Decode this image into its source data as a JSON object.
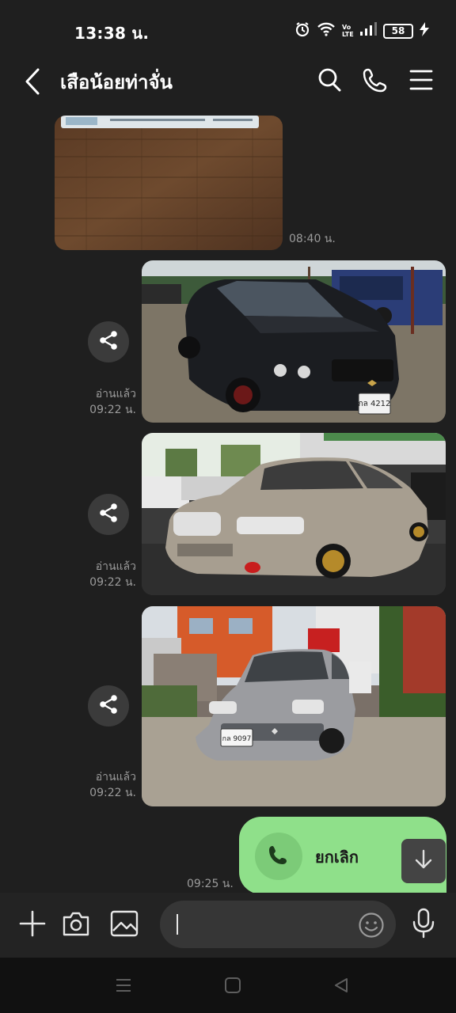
{
  "status_bar": {
    "time": "13:38 น.",
    "battery": "58",
    "network_label": "Vo LTE"
  },
  "header": {
    "title": "เสือน้อยท่าจั่น"
  },
  "messages": [
    {
      "type": "image",
      "sender": "them",
      "time": "08:40 น."
    },
    {
      "type": "image",
      "sender": "me",
      "read": "อ่านแล้ว",
      "time": "09:22 น."
    },
    {
      "type": "image",
      "sender": "me",
      "read": "อ่านแล้ว",
      "time": "09:22 น."
    },
    {
      "type": "image",
      "sender": "me",
      "read": "อ่านแล้ว",
      "time": "09:22 น."
    },
    {
      "type": "call",
      "sender": "me",
      "label": "ยกเลิก",
      "time": "09:25 น."
    }
  ],
  "plates": [
    "กล 4212",
    "กล 9097"
  ],
  "input": {
    "placeholder": ""
  },
  "colors": {
    "background": "#1f1f1f",
    "call_bubble": "#8fe08a"
  }
}
